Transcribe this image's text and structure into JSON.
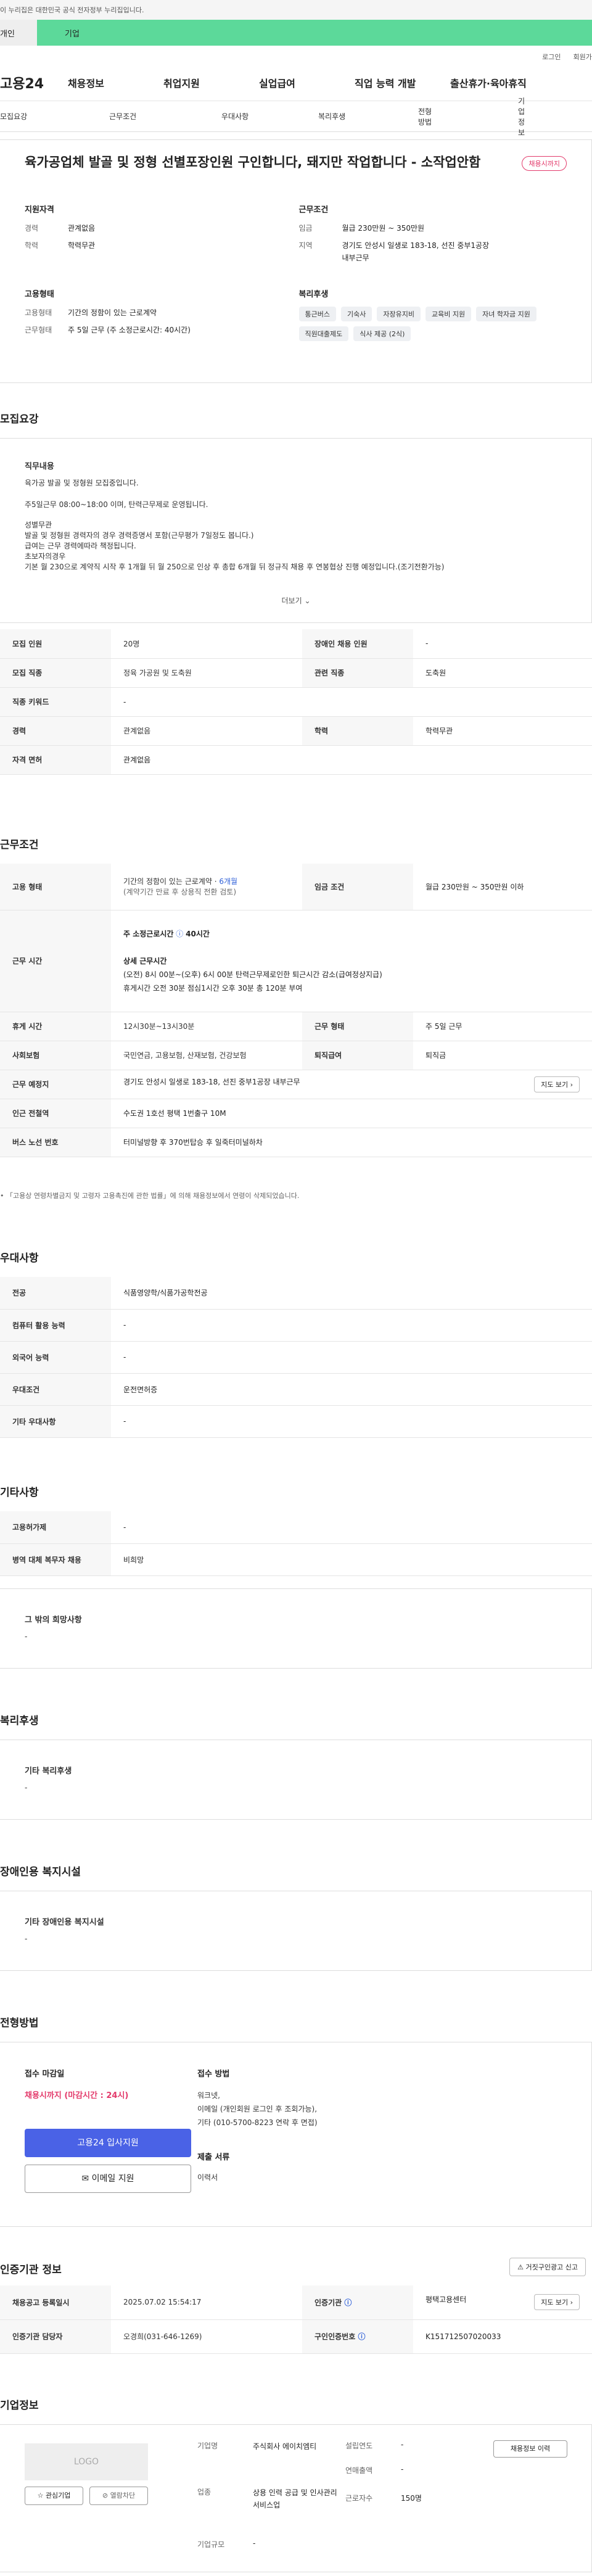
{
  "gov_banner": "이 누리집은 대한민국 공식 전자정부 누리집입니다.",
  "gnb_tabs": [
    "개인",
    "기업"
  ],
  "util": [
    "로그인",
    "회원가입"
  ],
  "logo": "고용24",
  "main_menu": [
    "채용정보",
    "취업지원",
    "실업급여",
    "직업 능력 개발",
    "출산휴가·육아휴직"
  ],
  "sub_tabs": [
    "모집요강",
    "근무조건",
    "우대사항",
    "복리후생",
    "전형방법",
    "기업정보"
  ],
  "summary": {
    "title": "육가공업체 발골 및 정형 선별포장인원 구인합니다, 돼지만 작업합니다 - 소작업안함",
    "badge": "채용시까지",
    "qual_title": "지원자격",
    "qual": [
      {
        "k": "경력",
        "v": "관계없음"
      },
      {
        "k": "학력",
        "v": "학력무관"
      }
    ],
    "cond_title": "근무조건",
    "cond": [
      {
        "k": "임금",
        "v": "월급 230만원 ~ 350만원"
      },
      {
        "k": "지역",
        "v": "경기도 안성시 일생로 183-18, 선진 중부1공장 내부근무"
      }
    ],
    "emp_title": "고용형태",
    "emp": [
      {
        "k": "고용형태",
        "v": "기간의 정함이 있는 근로계약"
      },
      {
        "k": "근무형태",
        "v": "주 5일 근무 (주 소정근로시간: 40시간)"
      }
    ],
    "welfare_title": "복리후생",
    "welfare": [
      "통근버스",
      "기숙사",
      "자장유지비",
      "교육비 지원",
      "자녀 학자금 지원",
      "직원대출제도",
      "식사 제공 (2식)"
    ]
  },
  "recruit": {
    "title": "모집요강",
    "detail_heading": "직무내용",
    "detail_lines": [
      "육가공 발골 및 정형원 모집중입니다.",
      "",
      "주5일근무 08:00~18:00 이며, 탄력근무제로 운영됩니다.",
      "",
      "성별무관",
      "발골 및 정형원 경력자의 경우 경력증명서 포함(근무평가 7일정도 봅니다.)",
      "급여는 근무 경력에따라 책정됩니다.",
      "초보자의경우",
      "기본 월 230으로 계약직 시작 후 1개월 뒤 월 250으로 인상 후 총합 6개월 뒤 정규직 채용 후 연봉협상 진행 예정입니다.(조기전환가능)"
    ],
    "more": "더보기",
    "rows": [
      [
        "모집 인원",
        "20명",
        "장애인 채용 인원",
        "-"
      ],
      [
        "모집 직종",
        "정육 가공원 및 도축원",
        "관련 직종",
        "도축원"
      ],
      [
        "직종 키워드",
        "-",
        "",
        ""
      ],
      [
        "경력",
        "관계없음",
        "학력",
        "학력무관"
      ],
      [
        "자격 면허",
        "관계없음",
        "",
        ""
      ]
    ]
  },
  "work": {
    "title": "근무조건",
    "emp_type_label": "고용 형태",
    "emp_type": "기간의 정함이 있는 근로계약 · ",
    "emp_period": "6개월",
    "emp_note": "(계약기간 만료 후 상용직 전환 검토)",
    "wage_label": "임금 조건",
    "wage": "월급 230만원 ~ 350만원 이하",
    "hours_label": "근무 시간",
    "hours_week": "주 소정근로시간",
    "hours_week_val": "40시간",
    "hours_detail_h": "상세 근무시간",
    "hours_detail": "(오전) 8시 00분~(오후) 6시 00분 탄력근무제로인한 퇴근시간 감소(급여정상지급)",
    "hours_break": "휴게시간 오전 30분 점심1시간 오후 30분 총 120분 부여",
    "rows": [
      [
        "휴게 시간",
        "12시30분~13시30분",
        "근무 형태",
        "주 5일 근무"
      ],
      [
        "사회보험",
        "국민연금, 고용보험, 산재보험, 건강보험",
        "퇴직급여",
        "퇴직금"
      ]
    ],
    "place_label": "근무 예정지",
    "place": "경기도 안성시 일생로 183-18, 선진 중부1공장 내부근무",
    "map_btn": "지도 보기",
    "subway_label": "인근 전철역",
    "subway": "수도권 1호선 평택 1번출구 10M",
    "bus_label": "버스 노선 번호",
    "bus": "터미널방향 후 370번탑승 후 일죽터미널하차",
    "note": "「고용상 연령차별금지 및 고령자 고용촉진에 관한 법률」에 의해 채용정보에서 연령이 삭제되었습니다."
  },
  "pref": {
    "title": "우대사항",
    "rows": [
      [
        "전공",
        "식품영양학/식품가공학전공"
      ],
      [
        "컴퓨터 활용 능력",
        "-"
      ],
      [
        "외국어 능력",
        "-"
      ],
      [
        "우대조건",
        "운전면허증"
      ],
      [
        "기타 우대사항",
        "-"
      ]
    ]
  },
  "etc": {
    "title": "기타사항",
    "rows": [
      [
        "고용허가제",
        "-"
      ],
      [
        "병역 대체 복무자 채용",
        "비희망"
      ]
    ],
    "other_h": "그 밖의 희망사항",
    "other_v": "-"
  },
  "welfare": {
    "title": "복리후생",
    "h": "기타 복리후생",
    "v": "-"
  },
  "disability": {
    "title": "장애인용 복지시설",
    "h": "기타 장애인용 복지시설",
    "v": "-"
  },
  "apply": {
    "title": "전형방법",
    "deadline_h": "접수 마감일",
    "deadline": "채용시까지 (마감시간 : 24시)",
    "apply_btn": "고용24 입사지원",
    "email_btn": "이메일 지원",
    "method_h": "접수 방법",
    "method": [
      "워크넷,",
      "이메일 (개인회원 로그인 후 조회가능),",
      "기타 (010-5700-8223 연락 후 면접)"
    ],
    "docs_h": "제출 서류",
    "docs": "이력서"
  },
  "agency": {
    "title": "인증기관 정보",
    "report": "거짓구인광고 신고",
    "rows": [
      [
        "채용공고 등록일시",
        "2025.07.02 15:54:17",
        "인증기관",
        "평택고용센터"
      ],
      [
        "인증기관 담당자",
        "오경희(031-646-1269)",
        "구인인증번호",
        "K151712507020033"
      ]
    ],
    "map_btn": "지도 보기"
  },
  "company": {
    "title": "기업정보",
    "logo_ph": "LOGO",
    "fav_btn": "관심기업",
    "block_btn": "열람차단",
    "name_k": "기업명",
    "name_v": "주식회사 에이치엠티",
    "industry_k": "업종",
    "industry_v": "상용 인력 공급 및 인사관리 서비스업",
    "size_k": "기업규모",
    "size_v": "-",
    "found_k": "설립연도",
    "found_v": "-",
    "sales_k": "연매출액",
    "sales_v": "-",
    "emp_k": "근로자수",
    "emp_v": "150명",
    "history_btn": "채용정보 이력"
  }
}
